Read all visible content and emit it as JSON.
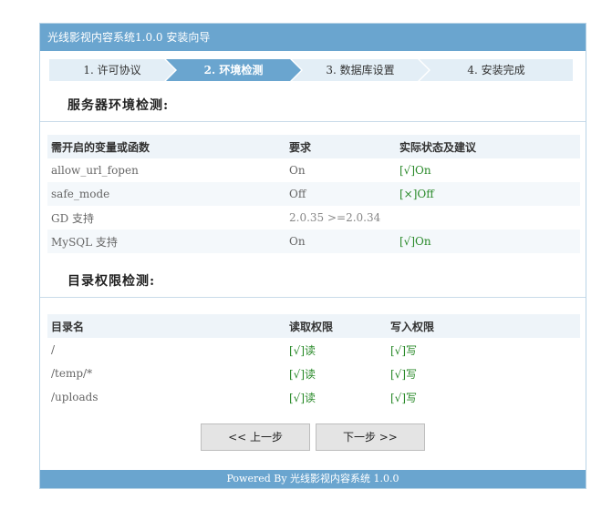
{
  "window": {
    "title": "光线影视内容系统1.0.0 安装向导"
  },
  "steps": [
    {
      "label": "1. 许可协议",
      "active": false
    },
    {
      "label": "2. 环境检测",
      "active": true
    },
    {
      "label": "3. 数据库设置",
      "active": false
    },
    {
      "label": "4. 安装完成",
      "active": false
    }
  ],
  "server_check": {
    "title": "服务器环境检测:",
    "headers": [
      "需开启的变量或函数",
      "要求",
      "实际状态及建议"
    ],
    "rows": [
      {
        "name": "allow_url_fopen",
        "required": "On",
        "status": "[√]On"
      },
      {
        "name": "safe_mode",
        "required": "Off",
        "status": "[×]Off"
      },
      {
        "name": "GD 支持",
        "required": "2.0.35 >=2.0.34",
        "status": ""
      },
      {
        "name": "MySQL 支持",
        "required": "On",
        "status": "[√]On"
      }
    ]
  },
  "dir_check": {
    "title": "目录权限检测:",
    "headers": [
      "目录名",
      "读取权限",
      "写入权限"
    ],
    "rows": [
      {
        "name": "/",
        "read": "[√]读",
        "write": "[√]写"
      },
      {
        "name": "/temp/*",
        "read": "[√]读",
        "write": "[√]写"
      },
      {
        "name": "/uploads",
        "read": "[√]读",
        "write": "[√]写"
      }
    ]
  },
  "buttons": {
    "prev": "<< 上一步",
    "next": "下一步 >>"
  },
  "footer": {
    "text": "Powered By 光线影视内容系统 1.0.0"
  },
  "colors": {
    "accent": "#6aa5cf",
    "step_bg": "#e3eef6",
    "step_active": "#6aa5cf",
    "ok": "#2a8a2a"
  }
}
